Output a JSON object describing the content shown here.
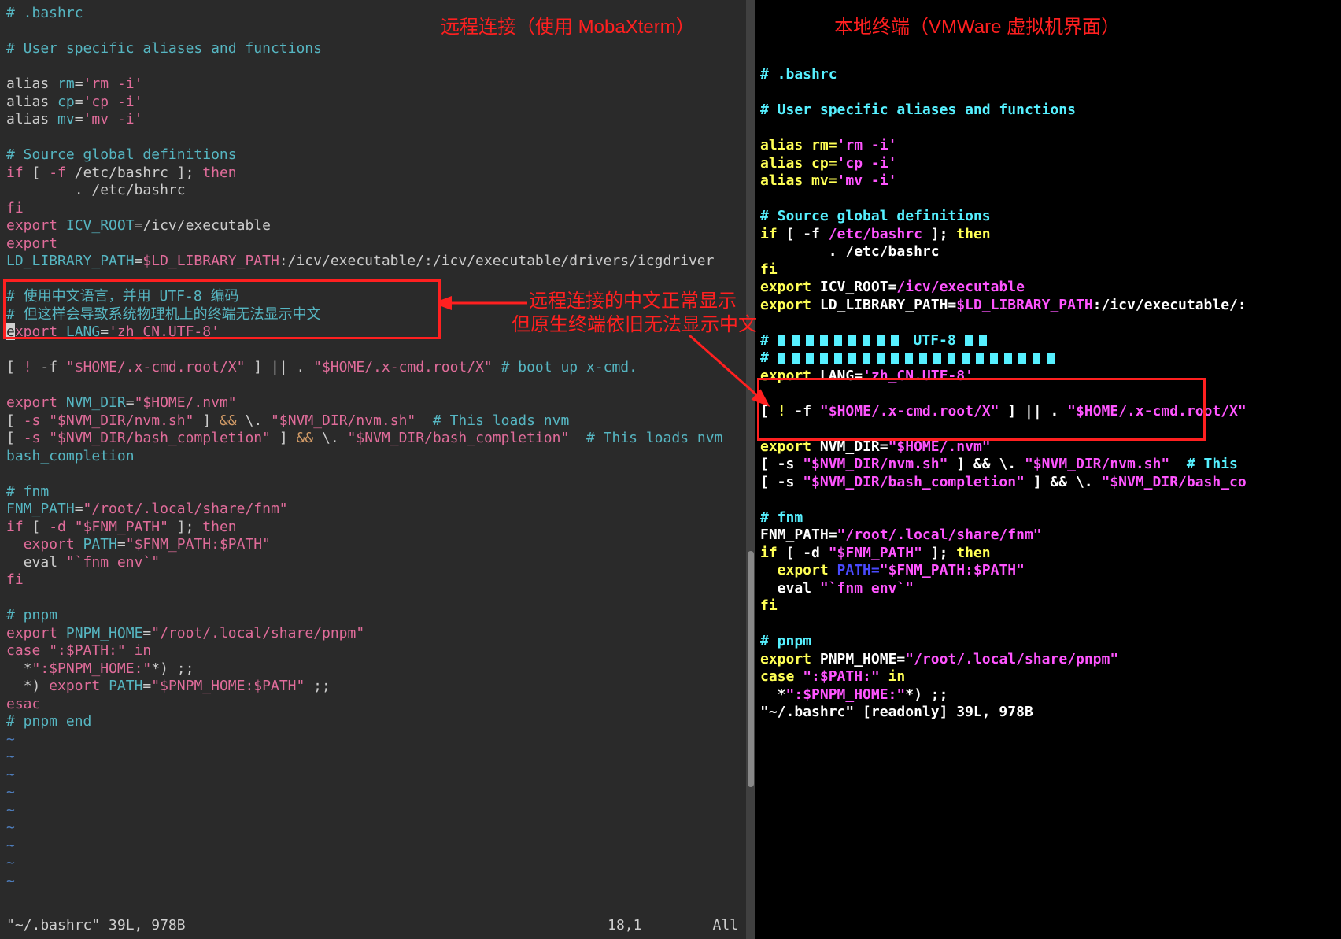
{
  "annotations": {
    "left_title": "远程连接（使用 MobaXterm）",
    "right_title": "本地终端（VMWare 虚拟机界面）",
    "note1": "远程连接的中文正常显示",
    "note2": "但原生终端依旧无法显示中文"
  },
  "left": {
    "l01": "# .bashrc",
    "l02": "# User specific aliases and functions",
    "l03a": "alias ",
    "l03b": "rm",
    "l03c": "=",
    "l03d": "'rm -i'",
    "l04a": "alias ",
    "l04b": "cp",
    "l04c": "=",
    "l04d": "'cp -i'",
    "l05a": "alias ",
    "l05b": "mv",
    "l05c": "=",
    "l05d": "'mv -i'",
    "l06": "# Source global definitions",
    "l07a": "if",
    "l07b": " [ ",
    "l07c": "-f",
    "l07d": " /etc/bashrc ]; ",
    "l07e": "then",
    "l08": "        . /etc/bashrc",
    "l09": "fi",
    "l10a": "export",
    "l10b": " ICV_ROOT",
    "l10c": "=/icv/executable",
    "l11a": "export",
    "l11b": " LD_LIBRARY_PATH",
    "l11c": "=",
    "l11d": "$LD_LIBRARY_PATH",
    "l11e": ":/icv/executable/:/icv/executable/drivers/icgdriver",
    "l12": "# 使用中文语言，并用 UTF-8 编码",
    "l13": "# 但这样会导致系统物理机上的终端无法显示中文",
    "l14a": "e",
    "l14b": "xport",
    "l14c": " LANG",
    "l14d": "=",
    "l14e": "'zh_CN.UTF-8'",
    "l15a": "[ ",
    "l15b": "!",
    "l15c": " -f ",
    "l15d": "\"$HOME/.x-cmd.root/X\"",
    "l15e": " ] || . ",
    "l15f": "\"$HOME/.x-cmd.root/X\"",
    "l15g": " # boot up x-cmd.",
    "l16a": "export",
    "l16b": " NVM_DIR",
    "l16c": "=",
    "l16d": "\"$HOME/.nvm\"",
    "l17a": "[ ",
    "l17b": "-s",
    "l17c": " \"$NVM_DIR/nvm.sh\"",
    "l17d": " ] ",
    "l17e": "&&",
    "l17f": " \\. ",
    "l17g": "\"$NVM_DIR/nvm.sh\"",
    "l17h": "  # This loads nvm",
    "l18a": "[ ",
    "l18b": "-s",
    "l18c": " \"$NVM_DIR/bash_completion\"",
    "l18d": " ] ",
    "l18e": "&&",
    "l18f": " \\. ",
    "l18g": "\"$NVM_DIR/bash_completion\"",
    "l18h": "  # This loads nvm bash_completion",
    "l19": "# fnm",
    "l20a": "FNM_PATH",
    "l20b": "=",
    "l20c": "\"/root/.local/share/fnm\"",
    "l21a": "if",
    "l21b": " [ ",
    "l21c": "-d",
    "l21d": " \"$FNM_PATH\"",
    "l21e": " ]; ",
    "l21f": "then",
    "l22a": "  export",
    "l22b": " PATH",
    "l22c": "=",
    "l22d": "\"$FNM_PATH:$PATH\"",
    "l23a": "  eval ",
    "l23b": "\"`fnm env`\"",
    "l24": "fi",
    "l25": "# pnpm",
    "l26a": "export",
    "l26b": " PNPM_HOME",
    "l26c": "=",
    "l26d": "\"/root/.local/share/pnpm\"",
    "l27a": "case",
    "l27b": " \":$PATH:\" ",
    "l27c": "in",
    "l28a": "  *",
    "l28b": "\":$PNPM_HOME:\"",
    "l28c": "*) ;;",
    "l29a": "  *) ",
    "l29b": "export",
    "l29c": " PATH",
    "l29d": "=",
    "l29e": "\"$PNPM_HOME:$PATH\"",
    "l29f": " ;;",
    "l30": "esac",
    "l31": "# pnpm end",
    "status_file": "\"~/.bashrc\" 39L, 978B",
    "status_pos": "18,1",
    "status_all": "All"
  },
  "right": {
    "r01": "# .bashrc",
    "r02": "# User specific aliases and functions",
    "r03a": "alias rm=",
    "r03b": "'rm -i'",
    "r04a": "alias cp=",
    "r04b": "'cp -i'",
    "r05a": "alias mv=",
    "r05b": "'mv -i'",
    "r06": "# Source global definitions",
    "r07a": "if",
    "r07b": " [ -f ",
    "r07c": "/etc/bashrc",
    "r07d": " ]; ",
    "r07e": "then",
    "r08": "        . /etc/bashrc",
    "r09": "fi",
    "r10a": "export",
    "r10b": " ICV_ROOT=",
    "r10c": "/icv/executable",
    "r11a": "export",
    "r11b": " LD_LIBRARY_PATH=",
    "r11c": "$LD_LIBRARY_PATH",
    "r11d": ":/icv/executable/:",
    "r12pre": "# ",
    "r12mid": " UTF-8 ",
    "r13pre": "# ",
    "r14a": "export",
    "r14b": " LANG=",
    "r14c": "'zh_CN.UTF-8'",
    "r15a": "[ ",
    "r15b": "!",
    "r15c": " -f ",
    "r15d": "\"$HOME/.x-cmd.root/X\"",
    "r15e": " ] || . ",
    "r15f": "\"$HOME/.x-cmd.root/X\"",
    "r16a": "export",
    "r16b": " NVM_DIR=",
    "r16c": "\"$HOME/.nvm\"",
    "r17a": "[ -s ",
    "r17b": "\"$NVM_DIR/nvm.sh\"",
    "r17c": " ] && \\. ",
    "r17d": "\"$NVM_DIR/nvm.sh\"",
    "r17e": "  # This",
    "r18a": "[ -s ",
    "r18b": "\"$NVM_DIR/bash_completion\"",
    "r18c": " ] && \\. ",
    "r18d": "\"$NVM_DIR/bash_co",
    "r19": "# fnm",
    "r20a": "FNM_PATH=",
    "r20b": "\"/root/.local/share/fnm\"",
    "r21a": "if",
    "r21b": " [ -d ",
    "r21c": "\"$FNM_PATH\"",
    "r21d": " ]; ",
    "r21e": "then",
    "r22a": "  export",
    "r22b": " PATH=",
    "r22c": "\"$FNM_PATH:$PATH\"",
    "r23a": "  eval ",
    "r23b": "\"`fnm env`\"",
    "r24": "fi",
    "r25": "# pnpm",
    "r26a": "export",
    "r26b": " PNPM_HOME=",
    "r26c": "\"/root/.local/share/pnpm\"",
    "r27a": "case",
    "r27b": " \":$PATH:\" ",
    "r27c": "in",
    "r28a": "  *",
    "r28b": "\":$PNPM_HOME:\"",
    "r28c": "*) ;;",
    "r29": "\"~/.bashrc\" [readonly] 39L, 978B"
  }
}
